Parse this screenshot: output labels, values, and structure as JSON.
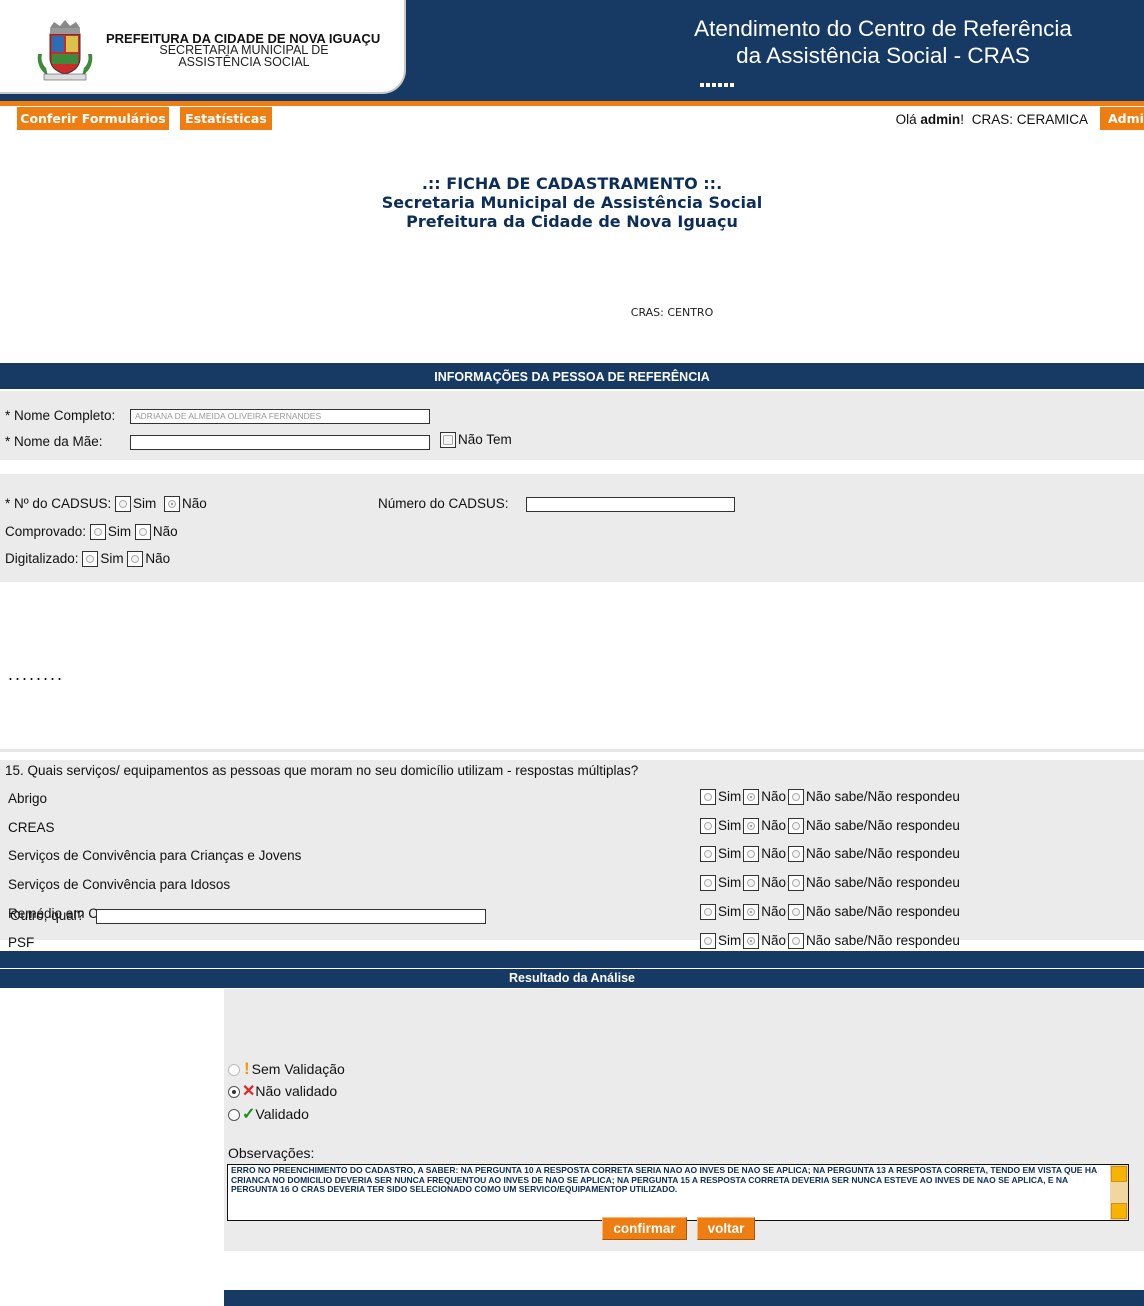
{
  "header": {
    "org_name": "PREFEITURA DA CIDADE DE NOVA IGUAÇU",
    "org_sub_line1": "SECRETARIA MUNICIPAL DE",
    "org_sub_line2": "ASSISTÊNCIA SOCIAL",
    "app_title_line1": "Atendimento do Centro de Referência",
    "app_title_line2": "da Assistência Social - CRAS",
    "crest_icon": "city-crest-icon"
  },
  "nav": {
    "items": [
      "Conferir Formulários",
      "Estatísticas"
    ],
    "greeting_prefix": "Olá ",
    "user": "admin",
    "greeting_suffix": "!",
    "cras_info": "CRAS: CERAMICA",
    "admin_tab": "Admi"
  },
  "form_title": {
    "line1": ".:: FICHA DE CADASTRAMENTO ::.",
    "line2": "Secretaria Municipal de Assistência Social",
    "line3": "Prefeitura da Cidade de Nova Iguaçu",
    "cras": "CRAS: CENTRO"
  },
  "section_ref": {
    "title": "INFORMAÇÕES DA PESSOA DE REFERÊNCIA",
    "nome_completo_label": "* Nome Completo:",
    "nome_completo_value": "ADRIANA DE ALMEIDA OLIVEIRA FERNANDES",
    "nome_mae_label": "* Nome da Mãe:",
    "nome_mae_value": "",
    "nao_tem_label": "Não Tem"
  },
  "cadsus": {
    "label": "* Nº do CADSUS:",
    "sim": "Sim",
    "nao": "Não",
    "numero_label": "Número do CADSUS:",
    "numero_value": "",
    "comprovado_label": "Comprovado:",
    "digitalizado_label": "Digitalizado:"
  },
  "ellipsis": "........",
  "q15": {
    "question": "15. Quais serviços/ equipamentos as pessoas que moram no seu domicílio utilizam - respostas múltiplas?",
    "options": [
      "Sim",
      "Não",
      "Não sabe/Não respondeu"
    ],
    "rows": [
      {
        "name": "Abrigo",
        "selected": "Não"
      },
      {
        "name": "CREAS",
        "selected": "Não"
      },
      {
        "name": "Serviços de Convivência para Crianças e Jovens",
        "selected": ""
      },
      {
        "name": "Serviços de Convivência para Idosos",
        "selected": ""
      },
      {
        "name": "Remédio em Casa",
        "selected": "Não"
      },
      {
        "name": "PSF",
        "selected": "Não"
      }
    ],
    "outro_label": "Outro, qual?",
    "outro_value": ""
  },
  "resultado": {
    "title": "Resultado da Análise",
    "options": [
      "Sem Validação",
      "Não validado",
      "Validado"
    ],
    "selected": "Não validado",
    "icons": [
      "warning-icon",
      "cross-icon",
      "check-icon"
    ],
    "obs_label": "Observações:",
    "obs_text": "ERRO NO PREENCHIMENTO DO CADASTRO, A SABER: NA PERGUNTA 10 A RESPOSTA CORRETA SERIA NAO AO INVES DE NAO SE APLICA; NA PERGUNTA 13 A RESPOSTA CORRETA, TENDO EM VISTA QUE HA CRIANCA NO DOMICILIO DEVERIA SER NUNCA FREQUENTOU AO INVES DE NAO SE APLICA; NA PERGUNTA 15 A RESPOSTA CORRETA DEVERIA SER NUNCA ESTEVE AO INVES DE NAO SE APLICA, E NA PERGUNTA 16 O CRAS DEVERIA TER SIDO SELECIONADO COMO UM SERVICO/EQUIPAMENTOP UTILIZADO.",
    "confirm": "confirmar",
    "back": "voltar"
  },
  "colors": {
    "navy": "#163a64",
    "orange": "#ee7d12",
    "panel_gray": "#ebebeb",
    "title_blue": "#0b2d57"
  }
}
